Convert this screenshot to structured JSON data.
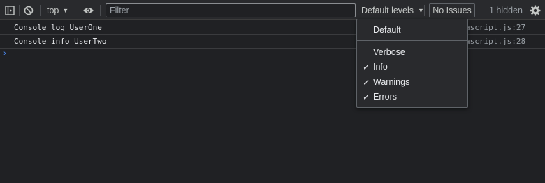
{
  "toolbar": {
    "context": "top",
    "filter_placeholder": "Filter",
    "levels_label": "Default levels",
    "issues_label": "No Issues",
    "hidden_label": "1 hidden"
  },
  "console": {
    "rows": [
      {
        "message": "Console log UserOne",
        "source": "ascript.js:27"
      },
      {
        "message": "Console info UserTwo",
        "source": "ascript.js:28"
      }
    ],
    "prompt": "›"
  },
  "levels_menu": {
    "default_label": "Default",
    "items": [
      {
        "label": "Verbose",
        "checked": false,
        "check": ""
      },
      {
        "label": "Info",
        "checked": true,
        "check": "✓"
      },
      {
        "label": "Warnings",
        "checked": true,
        "check": "✓"
      },
      {
        "label": "Errors",
        "checked": true,
        "check": "✓"
      }
    ]
  },
  "icons": {
    "toggle_sidebar": "sidebar-toggle-icon",
    "clear": "clear-console-icon",
    "eye": "live-expression-eye-icon",
    "settings": "gear-icon",
    "checkmark": "checkmark-icon",
    "chevron": "chevron-down-icon"
  },
  "colors": {
    "background": "#202124",
    "toolbar": "#292a2d",
    "text": "#e8eaed",
    "muted": "#9aa0a6",
    "prompt_accent": "#4d90fe"
  }
}
